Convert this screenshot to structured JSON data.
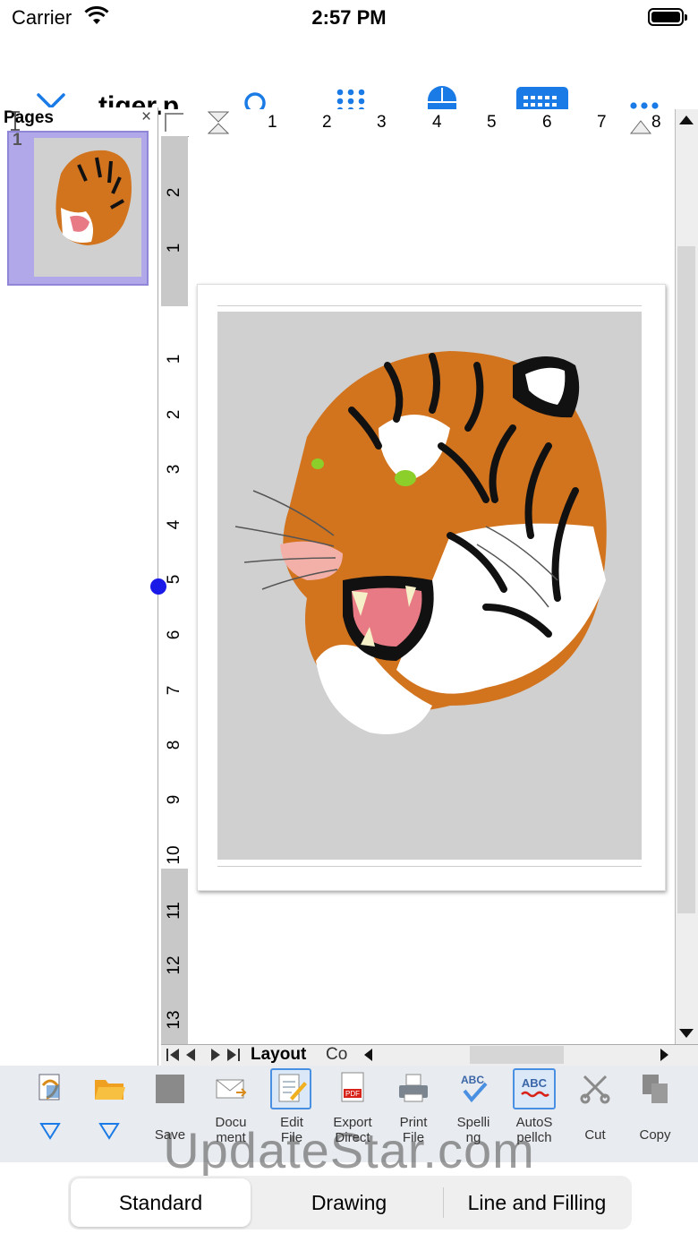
{
  "status_bar": {
    "carrier": "Carrier",
    "time": "2:57 PM"
  },
  "toolbar": {
    "title": "tiger.p...",
    "accent": "#1b7be6"
  },
  "pages_panel": {
    "title": "Pages",
    "close": "×",
    "page_number": "1"
  },
  "ruler_h": {
    "ticks": [
      "1",
      "2",
      "3",
      "4",
      "5",
      "6",
      "7",
      "8"
    ]
  },
  "ruler_v": {
    "ticks": [
      "2",
      "1",
      "1",
      "2",
      "3",
      "4",
      "5",
      "6",
      "7",
      "8",
      "9",
      "10",
      "11",
      "12",
      "13"
    ]
  },
  "sheet_tabs": {
    "layout": "Layout",
    "other": "Co"
  },
  "ribbon": {
    "items": [
      {
        "label": ""
      },
      {
        "label": ""
      },
      {
        "label": "Save"
      },
      {
        "label": "Docu\nment"
      },
      {
        "label": "Edit\nFile"
      },
      {
        "label": "Export\nDirect"
      },
      {
        "label": "Print\nFile"
      },
      {
        "label": "Spelli\nng"
      },
      {
        "label": "AutoS\npellch"
      },
      {
        "label": "Cut"
      },
      {
        "label": "Copy"
      }
    ]
  },
  "watermark": "UpdateStar.com",
  "segments": {
    "standard": "Standard",
    "drawing": "Drawing",
    "line_filling": "Line and Filling"
  }
}
